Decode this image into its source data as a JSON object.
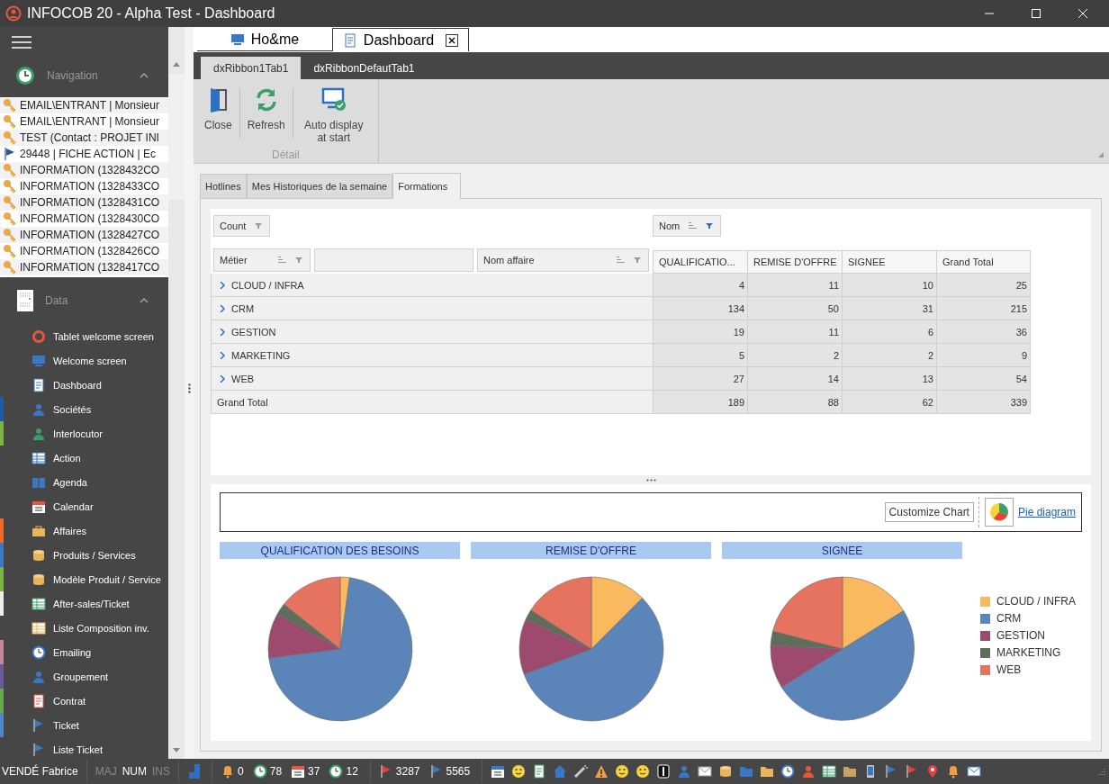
{
  "window": {
    "title": "INFOCOB 20 - Alpha Test - Dashboard"
  },
  "sidebar": {
    "navigation": {
      "title": "Navigation",
      "expanded": true,
      "items": [
        {
          "kind": "key",
          "label": "EMAIL\\ENTRANT | Monsieur"
        },
        {
          "kind": "key",
          "label": "EMAIL\\ENTRANT | Monsieur"
        },
        {
          "kind": "key",
          "label": "TEST (Contact : PROJET INI"
        },
        {
          "kind": "flag",
          "label": "29448 | FICHE ACTION | Ec"
        },
        {
          "kind": "key",
          "label": "INFORMATION (1328432CO"
        },
        {
          "kind": "key",
          "label": "INFORMATION (1328433CO"
        },
        {
          "kind": "key",
          "label": "INFORMATION (1328431CO"
        },
        {
          "kind": "key",
          "label": "INFORMATION (1328430CO"
        },
        {
          "kind": "key",
          "label": "INFORMATION (1328427CO"
        },
        {
          "kind": "key",
          "label": "INFORMATION (1328426CO"
        },
        {
          "kind": "key",
          "label": "INFORMATION (1328417CO"
        }
      ]
    },
    "data": {
      "title": "Data",
      "expanded": true,
      "items": [
        {
          "label": "Tablet welcome screen"
        },
        {
          "label": "Welcome screen"
        },
        {
          "label": "Dashboard"
        },
        {
          "label": "Sociétés",
          "color": "#1f5aa8"
        },
        {
          "label": "Interlocutor",
          "color": "#7cb342"
        },
        {
          "label": "Action"
        },
        {
          "label": "Agenda"
        },
        {
          "label": "Calendar"
        },
        {
          "label": "Affaires",
          "color": "#f06a2a"
        },
        {
          "label": "Produits / Services",
          "color": "#3b78c4"
        },
        {
          "label": "Modèle Produit / Service",
          "color": "#7cb342"
        },
        {
          "label": "After-sales/Ticket",
          "color": "#eeeeee"
        },
        {
          "label": "Liste Composition inv."
        },
        {
          "label": "Emailing",
          "color": "#c48a9c"
        },
        {
          "label": "Groupement",
          "color": "#6a5a9a"
        },
        {
          "label": "Contrat",
          "color": "#6aa84f"
        },
        {
          "label": "Ticket",
          "color": "#4a86c8"
        },
        {
          "label": "Liste Ticket"
        }
      ]
    }
  },
  "document_tabs": [
    {
      "label": "Ho&me",
      "selected": false
    },
    {
      "label": "Dashboard",
      "selected": true
    }
  ],
  "ribbon": {
    "tabs": [
      {
        "label": "dxRibbon1Tab1",
        "selected": true
      },
      {
        "label": "dxRibbonDefautTab1",
        "selected": false
      }
    ],
    "buttons": [
      {
        "label": "Close"
      },
      {
        "label": "Refresh"
      },
      {
        "label": "Auto display at start"
      }
    ],
    "group": "Détail"
  },
  "view_tabs": [
    {
      "label": "Hotlines",
      "selected": false
    },
    {
      "label": "Mes Historiques de la semaine",
      "selected": false
    },
    {
      "label": "Formations",
      "selected": true
    }
  ],
  "pivot": {
    "data_field": "Count",
    "column_field": "Nom",
    "row_fields": [
      "Métier",
      "Nom affaire"
    ],
    "columns": [
      "QUALIFICATIO...",
      "REMISE D'OFFRE",
      "SIGNEE",
      "Grand Total"
    ],
    "rows": [
      {
        "label": "CLOUD / INFRA",
        "expanded": false,
        "values": [
          "4",
          "11",
          "10",
          "25"
        ]
      },
      {
        "label": "CRM",
        "expanded": false,
        "values": [
          "134",
          "50",
          "31",
          "215"
        ]
      },
      {
        "label": "GESTION",
        "expanded": false,
        "values": [
          "19",
          "11",
          "6",
          "36"
        ]
      },
      {
        "label": "MARKETING",
        "expanded": false,
        "values": [
          "5",
          "2",
          "2",
          "9"
        ]
      },
      {
        "label": "WEB",
        "expanded": false,
        "values": [
          "27",
          "14",
          "13",
          "54"
        ]
      }
    ],
    "total": {
      "label": "Grand Total",
      "values": [
        "189",
        "88",
        "62",
        "339"
      ]
    }
  },
  "charts": {
    "customize": "Customize Chart",
    "diagram_link": "Pie diagram",
    "legend": [
      {
        "label": "CLOUD / INFRA",
        "color": "#fbb95f"
      },
      {
        "label": "CRM",
        "color": "#5b84b8"
      },
      {
        "label": "GESTION",
        "color": "#9e4a6e"
      },
      {
        "label": "MARKETING",
        "color": "#5e6e5a"
      },
      {
        "label": "WEB",
        "color": "#e5735f"
      }
    ],
    "pies": [
      {
        "chart_data": {
          "type": "pie",
          "title": "QUALIFICATION DES BESOINS",
          "values": [
            2.1,
            70.9,
            10.1,
            2.6,
            14.3
          ]
        }
      },
      {
        "chart_data": {
          "type": "pie",
          "title": "REMISE D'OFFRE",
          "values": [
            12.5,
            56.8,
            12.5,
            2.3,
            15.9
          ]
        }
      },
      {
        "chart_data": {
          "type": "pie",
          "title": "SIGNEE",
          "values": [
            16.1,
            50.0,
            9.7,
            3.2,
            21.0
          ]
        }
      }
    ]
  },
  "status_bar": {
    "user": "VENDÉ Fabrice",
    "keys": [
      {
        "label": "MAJ",
        "on": false
      },
      {
        "label": "NUM",
        "on": true
      },
      {
        "label": "INS",
        "on": false
      }
    ],
    "counters": [
      "0",
      "78",
      "37",
      "12"
    ],
    "flags": [
      "3287",
      "5565"
    ]
  }
}
